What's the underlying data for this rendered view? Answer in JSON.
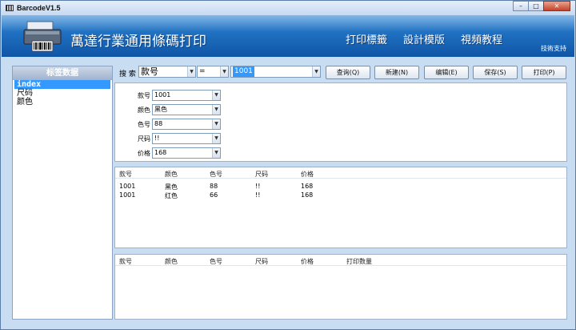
{
  "window": {
    "title": "BarcodeV1.5",
    "buttons": [
      "–",
      "□",
      "✕"
    ]
  },
  "banner": {
    "title": "萬達行業通用條碼打印",
    "nav": [
      "打印標籤",
      "設計模版",
      "視頻教程"
    ],
    "support": "技術支持"
  },
  "sidebar": {
    "header": "标签数据",
    "items": [
      {
        "label": "index",
        "selected": true
      },
      {
        "label": "尺码",
        "selected": false
      },
      {
        "label": "颜色",
        "selected": false
      }
    ]
  },
  "search": {
    "label": "搜 索",
    "field": "款号",
    "operator": "=",
    "value": "1001"
  },
  "toolbar": {
    "query": "查询(Q)",
    "new": "新建(N)",
    "edit": "编辑(E)",
    "save": "保存(S)",
    "print": "打印(P)"
  },
  "form": {
    "fields": [
      {
        "label": "款号",
        "value": "1001"
      },
      {
        "label": "颜色",
        "value": "黑色"
      },
      {
        "label": "色号",
        "value": "88"
      },
      {
        "label": "尺码",
        "value": "!!"
      },
      {
        "label": "价格",
        "value": "168"
      }
    ]
  },
  "grid1": {
    "columns": [
      "款号",
      "颜色",
      "色号",
      "尺码",
      "价格"
    ],
    "rows": [
      [
        "1001",
        "黑色",
        "88",
        "!!",
        "168"
      ],
      [
        "1001",
        "红色",
        "66",
        "!!",
        "168"
      ]
    ]
  },
  "grid2": {
    "columns": [
      "款号",
      "颜色",
      "色号",
      "尺码",
      "价格",
      "打印数量"
    ]
  },
  "colors": {
    "banner": "#1f6fc0",
    "selection": "#3399ff",
    "frame": "#c8dcf2"
  }
}
